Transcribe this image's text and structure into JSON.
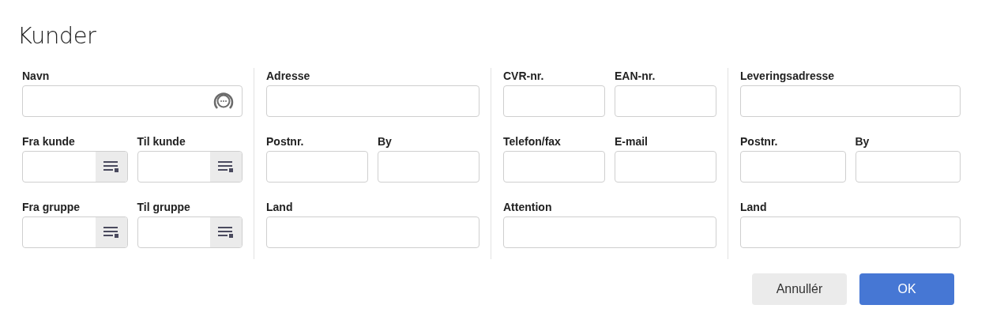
{
  "title": "Kunder",
  "columns": [
    {
      "rows": [
        [
          {
            "label": "Navn",
            "kind": "search"
          }
        ],
        [
          {
            "label": "Fra kunde",
            "kind": "lookup"
          },
          {
            "label": "Til kunde",
            "kind": "lookup"
          }
        ],
        [
          {
            "label": "Fra gruppe",
            "kind": "lookup"
          },
          {
            "label": "Til gruppe",
            "kind": "lookup"
          }
        ]
      ]
    },
    {
      "rows": [
        [
          {
            "label": "Adresse",
            "kind": "text"
          }
        ],
        [
          {
            "label": "Postnr.",
            "kind": "text"
          },
          {
            "label": "By",
            "kind": "text"
          }
        ],
        [
          {
            "label": "Land",
            "kind": "text"
          }
        ]
      ]
    },
    {
      "rows": [
        [
          {
            "label": "CVR-nr.",
            "kind": "text"
          },
          {
            "label": "EAN-nr.",
            "kind": "text"
          }
        ],
        [
          {
            "label": "Telefon/fax",
            "kind": "text"
          },
          {
            "label": "E-mail",
            "kind": "text"
          }
        ],
        [
          {
            "label": "Attention",
            "kind": "text"
          }
        ]
      ]
    },
    {
      "rows": [
        [
          {
            "label": "Leveringsadresse",
            "kind": "text"
          }
        ],
        [
          {
            "label": "Postnr.",
            "kind": "text"
          },
          {
            "label": "By",
            "kind": "text"
          }
        ],
        [
          {
            "label": "Land",
            "kind": "text"
          }
        ]
      ]
    }
  ],
  "buttons": [
    {
      "label": "Annullér",
      "kind": "secondary"
    },
    {
      "label": "OK",
      "kind": "primary"
    }
  ]
}
